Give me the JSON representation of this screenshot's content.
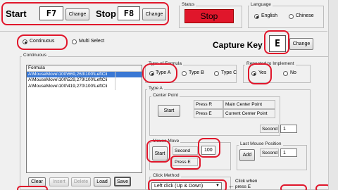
{
  "hotkeys": {
    "start_label": "Start",
    "start_key": "F7",
    "stop_label": "Stop",
    "stop_key": "F8",
    "change_label": "Change"
  },
  "status": {
    "group_label": "Status",
    "value": "Stop",
    "color": "#e0162b"
  },
  "language": {
    "group_label": "Language",
    "options": [
      "English",
      "Chinese"
    ],
    "selected": "English"
  },
  "mode": {
    "options": [
      "Continuous",
      "Multi Select"
    ],
    "selected": "Continuous"
  },
  "capture": {
    "label": "Capture Key",
    "key": "E",
    "change_label": "Change"
  },
  "continuous_group": {
    "label": "Continuous"
  },
  "formula_list": {
    "header": "Formula",
    "items": [
      "A\\MouseMove\\100\\669,263\\100\\LeftCli",
      "A\\MouseMove\\100\\529,279\\100\\LeftCli",
      "A\\MouseMove\\100\\419,270\\100\\LeftCli"
    ],
    "selected_index": 0
  },
  "bottom_buttons": {
    "clear": "Clear",
    "insert": "Insert",
    "delete": "Delete",
    "load": "Load",
    "save": "Save"
  },
  "formula_type": {
    "group_label": "Type of Formula",
    "options": [
      "Type A",
      "Type B",
      "Type C"
    ],
    "selected": "Type A"
  },
  "implement": {
    "group_label": "Repeated to Implement",
    "options": [
      "Yes",
      "No"
    ],
    "selected": "Yes"
  },
  "type_a": {
    "label": "Type A",
    "center_point": {
      "label": "Center Point",
      "start_label": "Start",
      "press_r": "Press R",
      "main_center": "Main Center Point",
      "press_e": "Press E",
      "current_center": "Current Center Point",
      "second_label": "Second",
      "second_value": "1"
    },
    "mouse_move": {
      "label": "Mouse Move",
      "start_label": "Start",
      "second_label": "Second",
      "second_value": "100",
      "press_e": "Press E"
    },
    "last_mouse": {
      "label": "Last Mouse Position",
      "add_label": "Add",
      "second_label": "Second",
      "second_value": "1"
    },
    "click_method": {
      "label": "Click Method",
      "selected": "Left click (Up & Down)",
      "hint": "Click when press E"
    }
  },
  "accent_colors": {
    "highlight": "#e0162b",
    "selection": "#3a78d4"
  }
}
